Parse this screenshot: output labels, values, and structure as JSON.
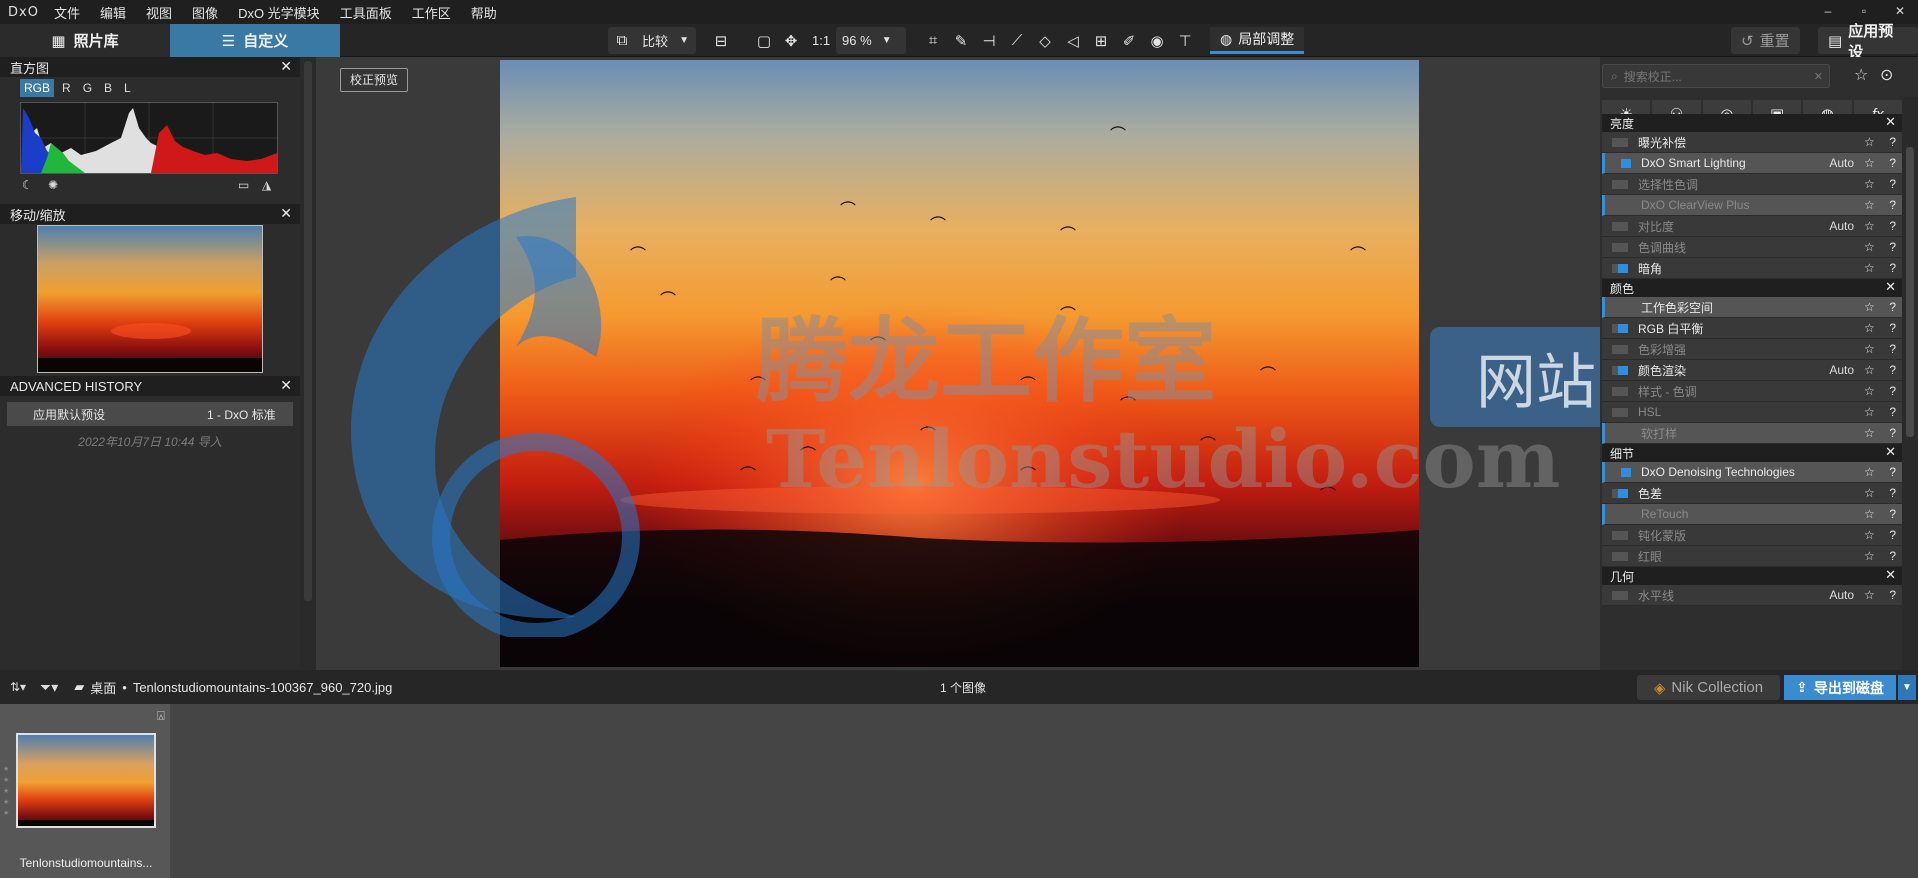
{
  "app": {
    "logo": "DxO"
  },
  "menu": [
    "文件",
    "编辑",
    "视图",
    "图像",
    "DxO 光学模块",
    "工具面板",
    "工作区",
    "帮助"
  ],
  "window_controls": [
    "–",
    "▫",
    "✕"
  ],
  "tabs": {
    "library": "照片库",
    "customize": "自定义"
  },
  "toolbar": {
    "compare": "比较",
    "one_to_one": "1:1",
    "zoom": "96 %",
    "local_adjust": "局部调整",
    "reset": "重置",
    "apply_preset": "应用预设"
  },
  "histogram": {
    "title": "直方图",
    "channels": [
      "RGB",
      "R",
      "G",
      "B",
      "L"
    ],
    "active_channel": "RGB"
  },
  "navigator": {
    "title": "移动/缩放"
  },
  "history": {
    "title": "ADVANCED HISTORY",
    "entry_label": "应用默认预设",
    "entry_value": "1 - DxO 标准",
    "date": "2022年10月7日 10:44 导入"
  },
  "viewer": {
    "preview_btn": "校正预览",
    "watermark_cn": "腾龙工作室",
    "watermark_site": "网站",
    "watermark_en": "Tenlonstudio.com"
  },
  "right": {
    "search_placeholder": "搜索校正...",
    "sections": [
      {
        "title": "亮度",
        "rows": [
          {
            "label": "曝光补偿",
            "on": false,
            "hl": false,
            "dim": false,
            "auto": ""
          },
          {
            "label": "DxO Smart Lighting",
            "on": true,
            "hl": true,
            "dim": false,
            "auto": "Auto"
          },
          {
            "label": "选择性色调",
            "on": false,
            "hl": false,
            "dim": true,
            "auto": ""
          },
          {
            "label": "DxO ClearView Plus",
            "on": false,
            "hl": true,
            "dim": true,
            "auto": ""
          },
          {
            "label": "对比度",
            "on": false,
            "hl": false,
            "dim": true,
            "auto": "Auto"
          },
          {
            "label": "色调曲线",
            "on": false,
            "hl": false,
            "dim": true,
            "auto": ""
          },
          {
            "label": "暗角",
            "on": true,
            "hl": false,
            "dim": false,
            "auto": ""
          }
        ]
      },
      {
        "title": "颜色",
        "rows": [
          {
            "label": "工作色彩空间",
            "on": false,
            "hl": true,
            "dim": false,
            "auto": ""
          },
          {
            "label": "RGB 白平衡",
            "on": true,
            "hl": false,
            "dim": false,
            "auto": ""
          },
          {
            "label": "色彩增强",
            "on": false,
            "hl": false,
            "dim": true,
            "auto": ""
          },
          {
            "label": "颜色渲染",
            "on": true,
            "hl": false,
            "dim": false,
            "auto": "Auto"
          },
          {
            "label": "样式 - 色调",
            "on": false,
            "hl": false,
            "dim": true,
            "auto": ""
          },
          {
            "label": "HSL",
            "on": false,
            "hl": false,
            "dim": true,
            "auto": ""
          },
          {
            "label": "软打样",
            "on": false,
            "hl": true,
            "dim": true,
            "auto": ""
          }
        ]
      },
      {
        "title": "细节",
        "rows": [
          {
            "label": "DxO Denoising Technologies",
            "on": true,
            "hl": true,
            "dim": false,
            "auto": ""
          },
          {
            "label": "色差",
            "on": true,
            "hl": false,
            "dim": false,
            "auto": ""
          },
          {
            "label": "ReTouch",
            "on": false,
            "hl": true,
            "dim": true,
            "auto": ""
          },
          {
            "label": "钝化蒙版",
            "on": false,
            "hl": false,
            "dim": true,
            "auto": ""
          },
          {
            "label": "红眼",
            "on": false,
            "hl": false,
            "dim": true,
            "auto": ""
          }
        ]
      },
      {
        "title": "几何",
        "rows": [
          {
            "label": "水平线",
            "on": false,
            "hl": false,
            "dim": true,
            "auto": "Auto"
          }
        ]
      }
    ]
  },
  "filmbar": {
    "folder": "桌面",
    "file": "Tenlonstudiomountains-100367_960_720.jpg",
    "count": "1 个图像",
    "nik": "Nik Collection",
    "export": "导出到磁盘"
  },
  "filmstrip": {
    "item_name": "Tenlonstudiomountains..."
  },
  "colors": {
    "accent": "#3a8fd0",
    "tab_active": "#3b79a5"
  }
}
